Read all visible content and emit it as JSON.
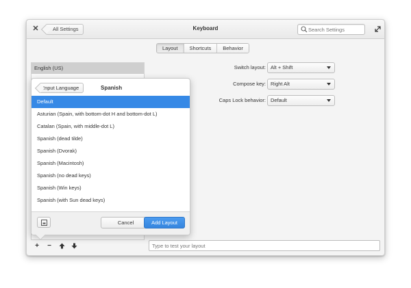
{
  "window": {
    "title": "Keyboard",
    "back_label": "All Settings",
    "search_placeholder": "Search Settings",
    "icons": {
      "close": "close-icon",
      "search": "search-icon",
      "expand": "expand-icon"
    }
  },
  "tabs": [
    {
      "label": "Layout",
      "active": true
    },
    {
      "label": "Shortcuts",
      "active": false
    },
    {
      "label": "Behavior",
      "active": false
    }
  ],
  "layouts": {
    "items": [
      {
        "label": "English (US)",
        "selected": true
      }
    ]
  },
  "settings": [
    {
      "label": "Switch layout:",
      "value": "Alt + Shift"
    },
    {
      "label": "Compose key:",
      "value": "Right Alt"
    },
    {
      "label": "Caps Lock behavior:",
      "value": "Default"
    }
  ],
  "toolbar": {
    "buttons": [
      "add-icon",
      "remove-icon",
      "move-up-icon",
      "move-down-icon"
    ]
  },
  "test_input": {
    "placeholder": "Type to test your layout"
  },
  "popover": {
    "back_label": "Input Language",
    "title": "Spanish",
    "variants": [
      "Default",
      "Asturian (Spain, with bottom-dot H and bottom-dot L)",
      "Catalan (Spain, with middle-dot L)",
      "Spanish (dead tilde)",
      "Spanish (Dvorak)",
      "Spanish (Macintosh)",
      "Spanish (no dead keys)",
      "Spanish (Win keys)",
      "Spanish (with Sun dead keys)"
    ],
    "selected_index": 0,
    "cancel_label": "Cancel",
    "add_label": "Add Layout",
    "accent_color": "#3689e6"
  }
}
